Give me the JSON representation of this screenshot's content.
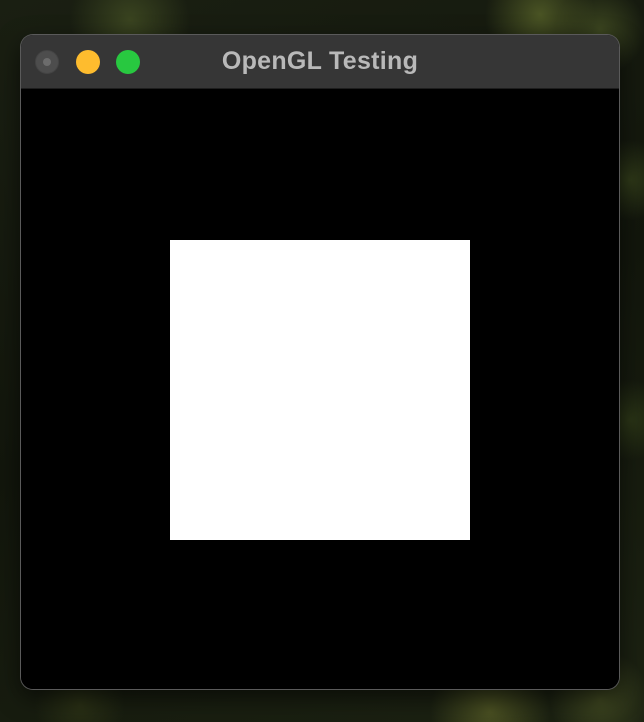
{
  "window": {
    "title": "OpenGL Testing"
  },
  "titlebar": {
    "buttons": [
      {
        "role": "close",
        "state": "inactive",
        "color": "#4d4d4d"
      },
      {
        "role": "minimize",
        "color": "#febc2e"
      },
      {
        "role": "zoom",
        "color": "#28c840"
      }
    ]
  },
  "viewport": {
    "clear_color": "#000000",
    "shape": {
      "kind": "square",
      "color": "#ffffff"
    }
  }
}
